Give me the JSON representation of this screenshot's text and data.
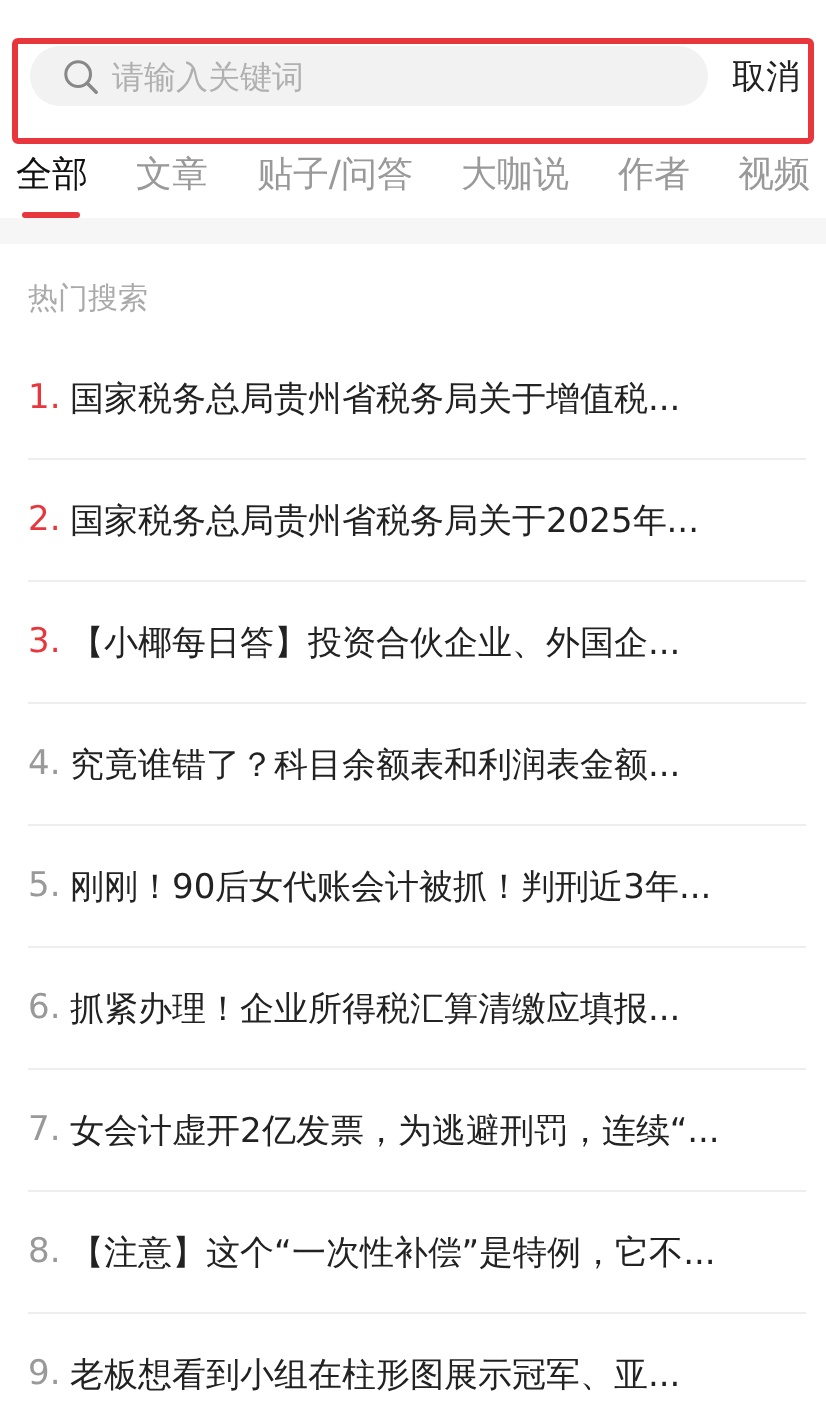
{
  "search": {
    "placeholder": "请输入关键词",
    "cancel": "取消"
  },
  "tabs": [
    {
      "label": "全部",
      "selected": true
    },
    {
      "label": "文章",
      "selected": false
    },
    {
      "label": "贴子/问答",
      "selected": false
    },
    {
      "label": "大咖说",
      "selected": false
    },
    {
      "label": "作者",
      "selected": false
    },
    {
      "label": "视频",
      "selected": false
    }
  ],
  "hot_search": {
    "title": "热门搜索",
    "items": [
      {
        "rank": "1.",
        "hot": true,
        "text": "国家税务总局贵州省税务局关于增值税..."
      },
      {
        "rank": "2.",
        "hot": true,
        "text": "国家税务总局贵州省税务局关于2025年..."
      },
      {
        "rank": "3.",
        "hot": true,
        "text": "【小椰每日答】投资合伙企业、外国企..."
      },
      {
        "rank": "4.",
        "hot": false,
        "text": "究竟谁错了？科目余额表和利润表金额..."
      },
      {
        "rank": "5.",
        "hot": false,
        "text": "刚刚！90后女代账会计被抓！判刑近3年..."
      },
      {
        "rank": "6.",
        "hot": false,
        "text": "抓紧办理！企业所得税汇算清缴应填报..."
      },
      {
        "rank": "7.",
        "hot": false,
        "text": "女会计虚开2亿发票，为逃避刑罚，连续“..."
      },
      {
        "rank": "8.",
        "hot": false,
        "text": "【注意】这个“一次性补偿”是特例，它不..."
      },
      {
        "rank": "9.",
        "hot": false,
        "text": "老板想看到小组在柱形图展示冠军、亚..."
      }
    ]
  }
}
